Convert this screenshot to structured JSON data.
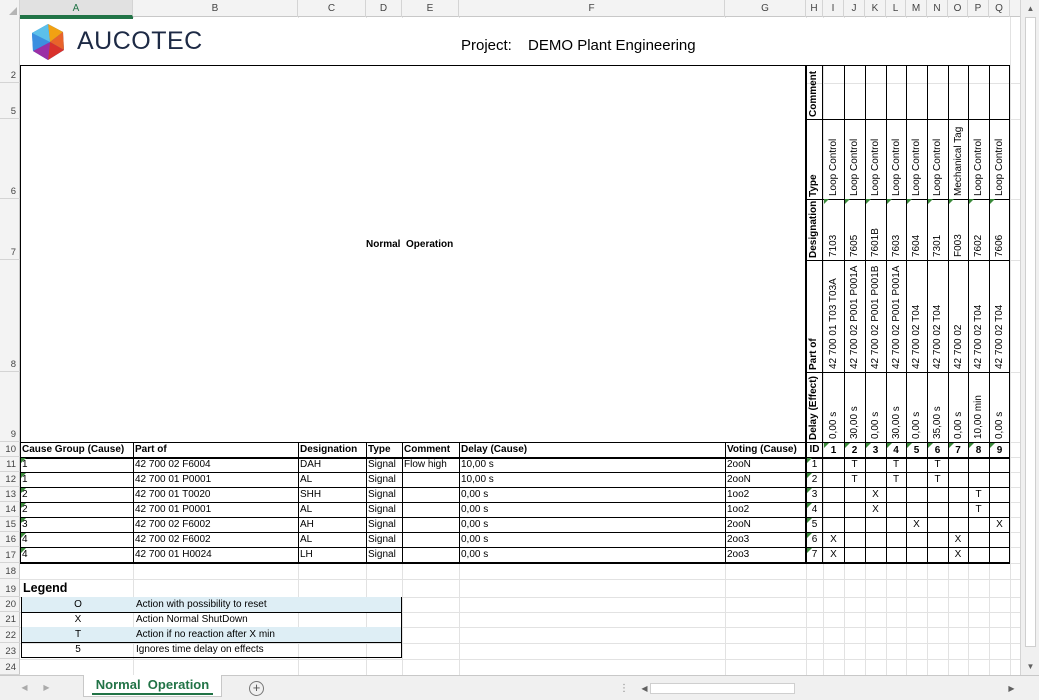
{
  "columns": [
    {
      "letter": "A",
      "selected": true
    },
    {
      "letter": "B"
    },
    {
      "letter": "C"
    },
    {
      "letter": "D"
    },
    {
      "letter": "E"
    },
    {
      "letter": "F"
    },
    {
      "letter": "G"
    },
    {
      "letter": "H"
    },
    {
      "letter": "I"
    },
    {
      "letter": "J"
    },
    {
      "letter": "K"
    },
    {
      "letter": "L"
    },
    {
      "letter": "M"
    },
    {
      "letter": "N"
    },
    {
      "letter": "O"
    },
    {
      "letter": "P"
    },
    {
      "letter": "Q"
    }
  ],
  "rows": [
    "2",
    "5",
    "6",
    "7",
    "8",
    "9",
    "10",
    "11",
    "12",
    "13",
    "14",
    "15",
    "16",
    "17",
    "18",
    "19",
    "20",
    "21",
    "22",
    "23",
    "24"
  ],
  "logo": {
    "text": "AUCOTEC"
  },
  "project": {
    "label": "Project:",
    "value": "DEMO Plant Engineering"
  },
  "matrix_title": "Normal  Operation",
  "effect_header_labels": {
    "comment": "Comment",
    "type": "Type",
    "designation": "Designation",
    "part_of": "Part of",
    "delay": "Delay (Effect)"
  },
  "effects": [
    {
      "id": "1",
      "type": "Loop Control",
      "designation": "7103",
      "part_of": "42 700 01 T03 T03A",
      "delay": "0,00 s"
    },
    {
      "id": "2",
      "type": "Loop Control",
      "designation": "7605",
      "part_of": "42 700 02 P001 P001A",
      "delay": "30,00 s"
    },
    {
      "id": "3",
      "type": "Loop Control",
      "designation": "7601B",
      "part_of": "42 700 02 P001 P001B",
      "delay": "0,00 s"
    },
    {
      "id": "4",
      "type": "Loop Control",
      "designation": "7603",
      "part_of": "42 700 02 P001 P001A",
      "delay": "30,00 s"
    },
    {
      "id": "5",
      "type": "Loop Control",
      "designation": "7604",
      "part_of": "42 700 02 T04",
      "delay": "0,00 s"
    },
    {
      "id": "6",
      "type": "Loop Control",
      "designation": "7301",
      "part_of": "42 700 02 T04",
      "delay": "35,00 s"
    },
    {
      "id": "7",
      "type": "Mechanical Tag",
      "designation": "F003",
      "part_of": "42 700 02",
      "delay": "0,00 s"
    },
    {
      "id": "8",
      "type": "Loop Control",
      "designation": "7602",
      "part_of": "42 700 02 T04",
      "delay": "10,00 min"
    },
    {
      "id": "9",
      "type": "Loop Control",
      "designation": "7606",
      "part_of": "42 700 02 T04",
      "delay": "0,00 s"
    }
  ],
  "cause_headers": {
    "group": "Cause Group (Cause)",
    "part_of": "Part of",
    "designation": "Designation",
    "type": "Type",
    "comment": "Comment",
    "delay": "Delay (Cause)",
    "voting": "Voting (Cause)",
    "id": "ID"
  },
  "causes": [
    {
      "group": "1",
      "part_of": "42 700 02 F6004",
      "designation": "DAH",
      "type": "Signal",
      "comment": "Flow high",
      "delay": "10,00 s",
      "voting": "2ooN",
      "id": "1",
      "marks": [
        "",
        "T",
        "",
        "T",
        "",
        "T",
        "",
        "",
        ""
      ]
    },
    {
      "group": "1",
      "part_of": "42 700 01 P0001",
      "designation": "AL",
      "type": "Signal",
      "comment": "",
      "delay": "10,00 s",
      "voting": "2ooN",
      "id": "2",
      "marks": [
        "",
        "T",
        "",
        "T",
        "",
        "T",
        "",
        "",
        ""
      ]
    },
    {
      "group": "2",
      "part_of": "42 700 01 T0020",
      "designation": "SHH",
      "type": "Signal",
      "comment": "",
      "delay": "0,00 s",
      "voting": "1oo2",
      "id": "3",
      "marks": [
        "",
        "",
        "X",
        "",
        "",
        "",
        "",
        "T",
        ""
      ]
    },
    {
      "group": "2",
      "part_of": "42 700 01 P0001",
      "designation": "AL",
      "type": "Signal",
      "comment": "",
      "delay": "0,00 s",
      "voting": "1oo2",
      "id": "4",
      "marks": [
        "",
        "",
        "X",
        "",
        "",
        "",
        "",
        "T",
        ""
      ]
    },
    {
      "group": "3",
      "part_of": "42 700 02 F6002",
      "designation": "AH",
      "type": "Signal",
      "comment": "",
      "delay": "0,00 s",
      "voting": "2ooN",
      "id": "5",
      "marks": [
        "",
        "",
        "",
        "",
        "X",
        "",
        "",
        "",
        "X"
      ]
    },
    {
      "group": "4",
      "part_of": "42 700 02 F6002",
      "designation": "AL",
      "type": "Signal",
      "comment": "",
      "delay": "0,00 s",
      "voting": "2oo3",
      "id": "6",
      "marks": [
        "X",
        "",
        "",
        "",
        "",
        "",
        "X",
        "",
        ""
      ]
    },
    {
      "group": "4",
      "part_of": "42 700 01 H0024",
      "designation": "LH",
      "type": "Signal",
      "comment": "",
      "delay": "0,00 s",
      "voting": "2oo3",
      "id": "7",
      "marks": [
        "X",
        "",
        "",
        "",
        "",
        "",
        "X",
        "",
        ""
      ]
    }
  ],
  "legend": {
    "title": "Legend",
    "items": [
      {
        "symbol": "O",
        "text": "Action with possibility to reset"
      },
      {
        "symbol": "X",
        "text": "Action Normal ShutDown"
      },
      {
        "symbol": "T",
        "text": "Action if no reaction after X min"
      },
      {
        "symbol": "5",
        "text": "Ignores time delay on effects"
      }
    ]
  },
  "sheet_tab": "Normal  Operation",
  "colors": {
    "accent": "#217346",
    "legend_shade": "#deeef5",
    "comment_marker": "#3a8a3a"
  }
}
